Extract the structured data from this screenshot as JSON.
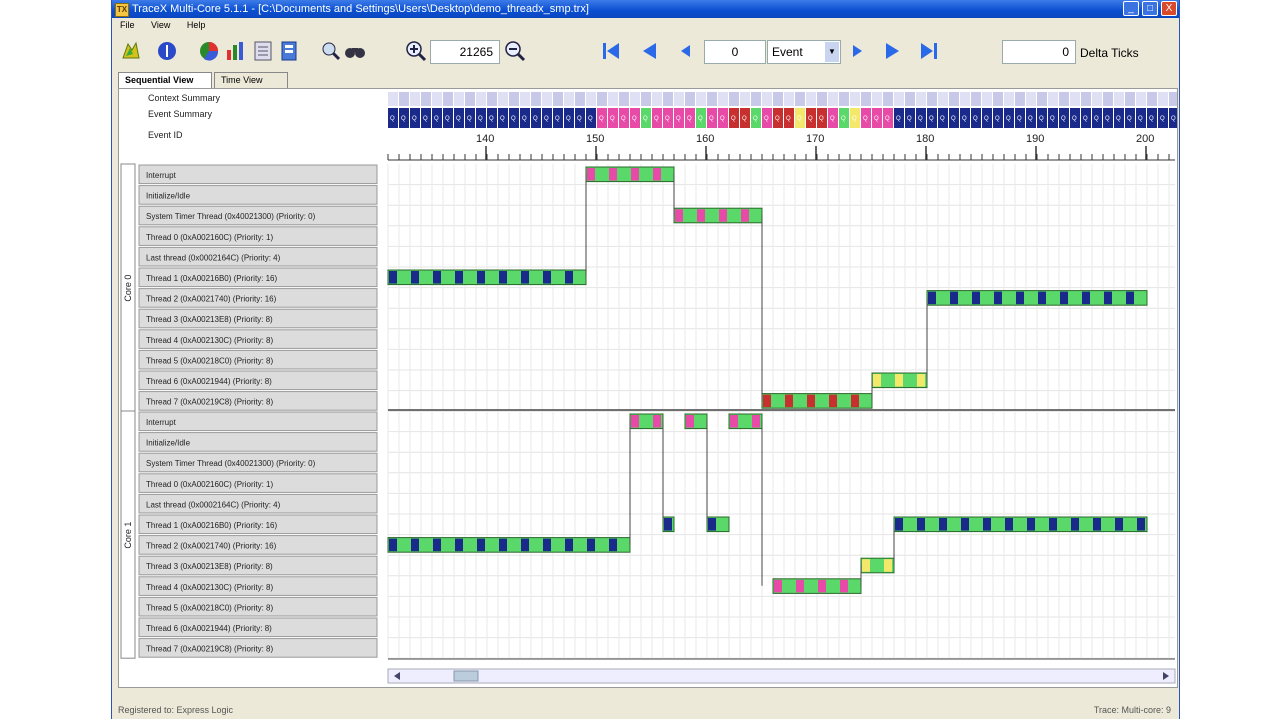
{
  "window": {
    "title": "TraceX Multi-Core 5.1.1 - [C:\\Documents and Settings\\Users\\Desktop\\demo_threadx_smp.trx]",
    "app_icon": "TX",
    "controls": {
      "minimize": "_",
      "maximize": "□",
      "close": "X"
    },
    "colors": {
      "titlebar": "#0a4fd0",
      "close": "#d84a2a"
    }
  },
  "menu": {
    "items": [
      "File",
      "View",
      "Help"
    ]
  },
  "toolbar": {
    "icons": [
      "open-icon",
      "info-icon",
      "pie-chart-icon",
      "bar-chart-icon",
      "list-icon",
      "stack-icon",
      "search-icon",
      "binoculars-icon",
      "zoom-in-icon",
      "zoom-out-icon",
      "first-icon",
      "prev-page-icon",
      "prev-icon",
      "next-icon",
      "next-page-icon",
      "last-icon"
    ],
    "zoom_value": "21265",
    "event_value": "0",
    "event_select": "Event",
    "delta_value": "0",
    "delta_label": "Delta Ticks"
  },
  "tabs": [
    {
      "label": "Sequential View",
      "active": true
    },
    {
      "label": "Time View",
      "active": false
    }
  ],
  "header_rows": {
    "context_summary": "Context Summary",
    "event_summary": "Event Summary",
    "event_id": "Event ID"
  },
  "ruler": {
    "labels": [
      "140",
      "150",
      "160",
      "170",
      "180",
      "190",
      "200"
    ]
  },
  "cores": [
    {
      "label": "Core 0",
      "rows": [
        "Interrupt",
        "Initialize/Idle",
        "System Timer Thread (0x40021300) (Priority: 0)",
        "Thread 0 (0xA002160C) (Priority: 1)",
        "Last thread (0x0002164C) (Priority: 4)",
        "Thread 1 (0xA00216B0) (Priority: 16)",
        "Thread 2 (0xA0021740) (Priority: 16)",
        "Thread 3 (0xA00213E8) (Priority: 8)",
        "Thread 4 (0xA002130C) (Priority: 8)",
        "Thread 5 (0xA00218C0) (Priority: 8)",
        "Thread 6 (0xA0021944) (Priority: 8)",
        "Thread 7 (0xA00219C8) (Priority: 8)"
      ]
    },
    {
      "label": "Core 1",
      "rows": [
        "Interrupt",
        "Initialize/Idle",
        "System Timer Thread (0x40021300) (Priority: 0)",
        "Thread 0 (0xA002160C) (Priority: 1)",
        "Last thread (0x0002164C) (Priority: 4)",
        "Thread 1 (0xA00216B0) (Priority: 16)",
        "Thread 2 (0xA0021740) (Priority: 16)",
        "Thread 3 (0xA00213E8) (Priority: 8)",
        "Thread 4 (0xA002130C) (Priority: 8)",
        "Thread 5 (0xA00218C0) (Priority: 8)",
        "Thread 6 (0xA0021944) (Priority: 8)",
        "Thread 7 (0xA00219C8) (Priority: 8)"
      ]
    }
  ],
  "event_colors": {
    "green": "#5ad86a",
    "navy": "#1a2a8a",
    "pink": "#e84aa8",
    "red": "#c83030",
    "yellow": "#f4e86a"
  },
  "status": {
    "left": "Registered to: Express Logic",
    "right": "Trace: Multi-core: 9"
  }
}
